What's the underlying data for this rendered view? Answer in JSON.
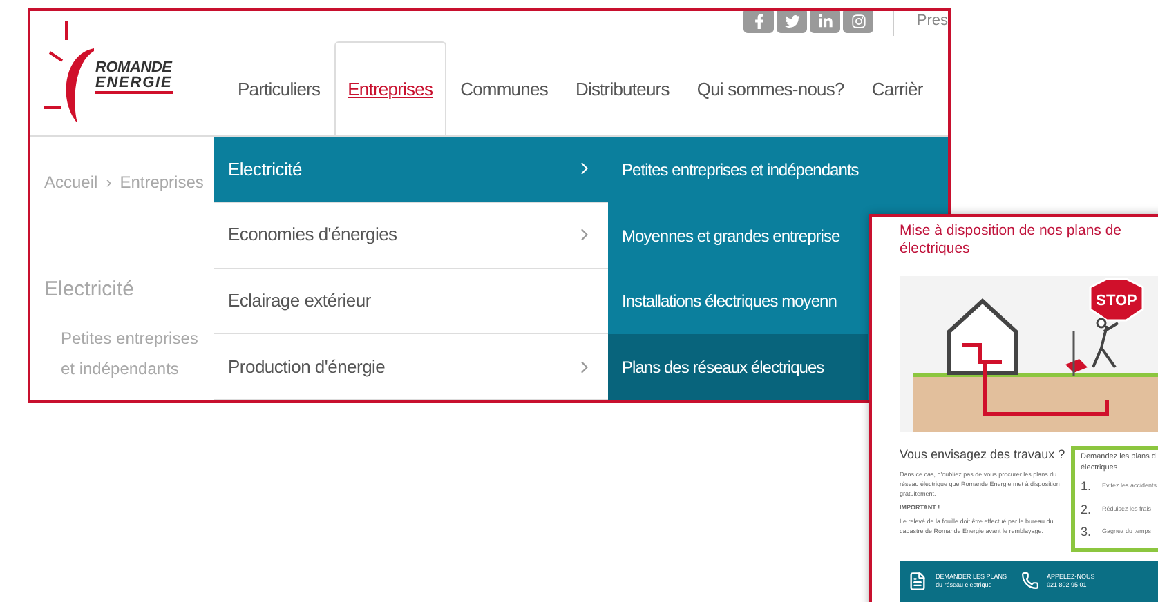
{
  "logo": {
    "line_1": "ROMANDE",
    "line_2": "ENERGIE"
  },
  "social_links": [
    {
      "kind": "facebook"
    },
    {
      "kind": "twitter"
    },
    {
      "kind": "linkedin"
    },
    {
      "kind": "instagram"
    }
  ],
  "top_link": "Pres",
  "nav": [
    {
      "label": "Particuliers",
      "selected": false
    },
    {
      "label": "Entreprises",
      "selected": true
    },
    {
      "label": "Communes",
      "selected": false
    },
    {
      "label": "Distributeurs",
      "selected": false
    },
    {
      "label": "Qui sommes-nous?",
      "selected": false
    },
    {
      "label": "Carrièr",
      "selected": false
    }
  ],
  "breadcrumb": [
    "Accueil",
    "›",
    "Entreprises"
  ],
  "sidebar": {
    "title": "Electricité",
    "links": [
      "Petites entreprises et indépendants"
    ]
  },
  "menu": {
    "categories": [
      {
        "label": "Electricité",
        "selected": true,
        "has_submenu": true
      },
      {
        "label": "Economies d'énergies",
        "selected": false,
        "has_submenu": true
      },
      {
        "label": "Eclairage extérieur",
        "selected": false,
        "has_submenu": false
      },
      {
        "label": "Production d'énergie",
        "selected": false,
        "has_submenu": true
      }
    ],
    "subitems": [
      {
        "label": "Petites entreprises et indépendants",
        "selected": false
      },
      {
        "label": "Moyennes et grandes entreprise",
        "selected": false
      },
      {
        "label": "Installations électriques moyenn",
        "selected": false
      },
      {
        "label": "Plans des réseaux électriques",
        "selected": true
      }
    ]
  },
  "flyer": {
    "title_lines": [
      "Mise à disposition de nos plans de",
      "électriques"
    ],
    "illustration_label": "STOP",
    "heading": "Vous envisagez des travaux ?",
    "paragraphs": [
      {
        "text": "Dans ce cas, n'oubliez pas de vous procurer les plans du réseau électrique que Romande Energie met à disposition gratuitement.",
        "bold": false
      },
      {
        "text": "IMPORTANT !",
        "bold": true
      },
      {
        "text": "Le relevé de la fouille doit être effectué par le bureau du cadastre de Romande Energie avant le remblayage.",
        "bold": false
      }
    ],
    "steps_title_lines": [
      "Demandez les plans d",
      "électriques"
    ],
    "steps": [
      {
        "number": "1.",
        "text": "Evitez les accidents"
      },
      {
        "number": "2.",
        "text": "Réduisez les frais"
      },
      {
        "number": "3.",
        "text": "Gagnez du temps"
      }
    ],
    "footer_actions": [
      {
        "kind": "document",
        "title": "DEMANDER LES PLANS",
        "subtitle": "du réseau électrique"
      },
      {
        "kind": "phone",
        "title": "APPELEZ-NOUS",
        "subtitle": "021 802 95 01"
      }
    ]
  }
}
